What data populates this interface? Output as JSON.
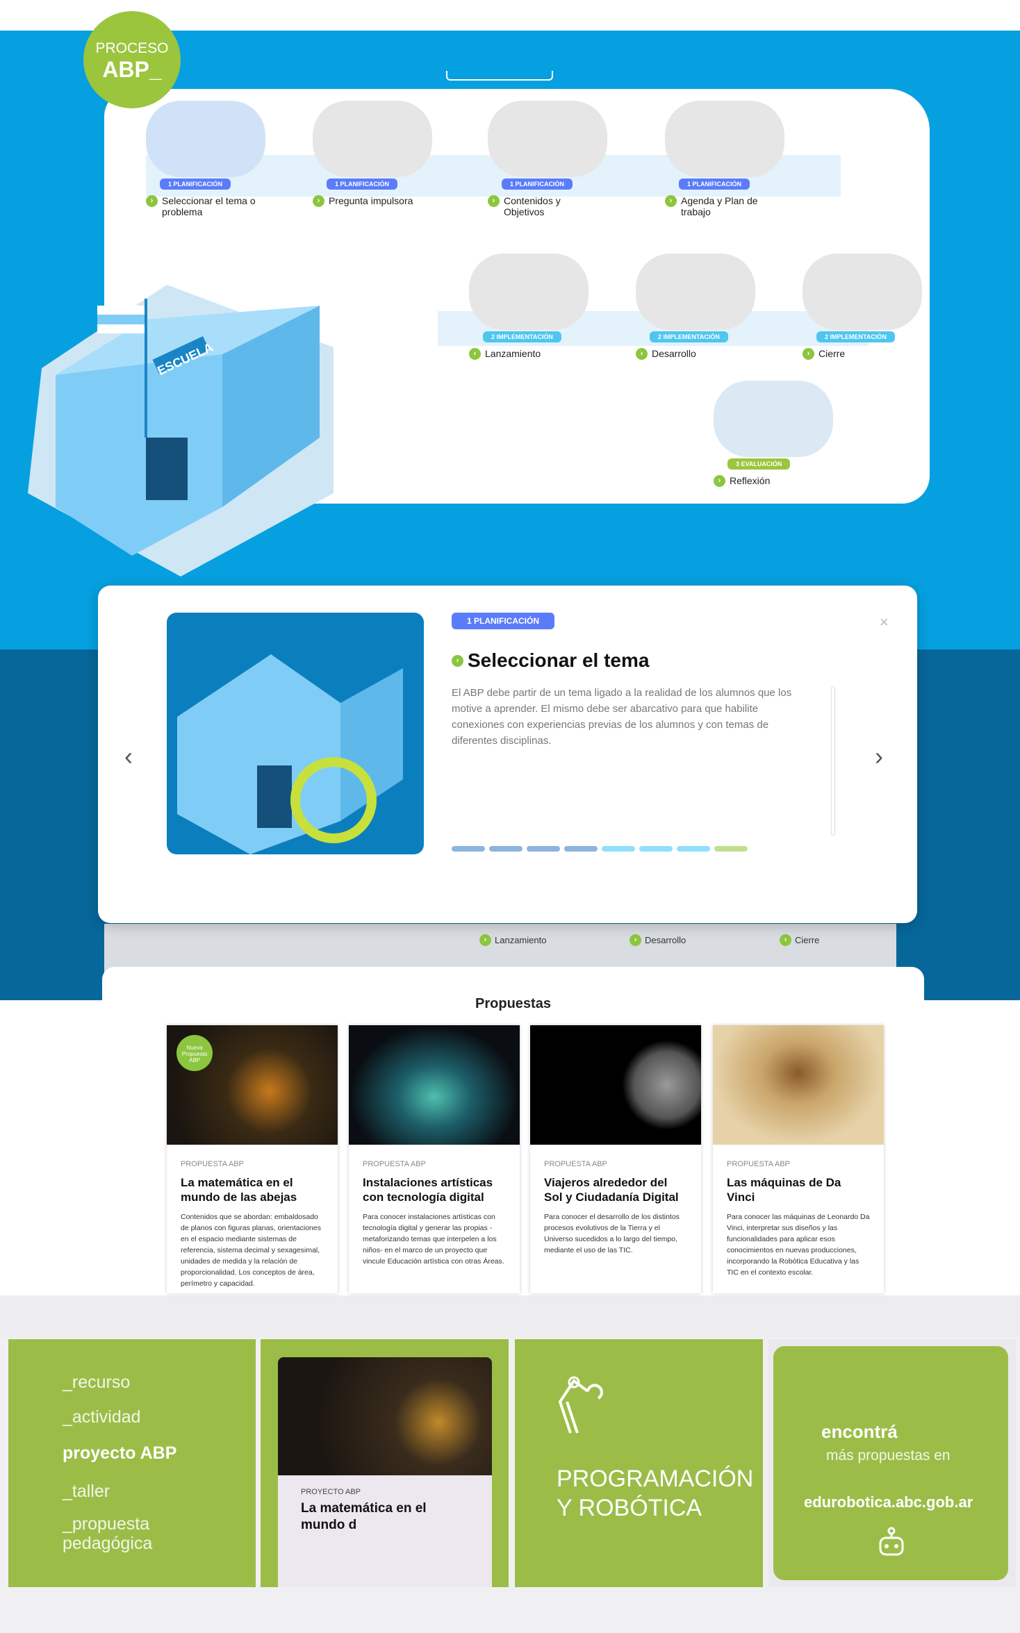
{
  "logo": {
    "line1": "PROCESO",
    "line2": "ABP_"
  },
  "steps": [
    {
      "badge": "1 PLANIFICACIÓN",
      "label": "Seleccionar el tema o problema",
      "phase": 1
    },
    {
      "badge": "1 PLANIFICACIÓN",
      "label": "Pregunta impulsora",
      "phase": 1
    },
    {
      "badge": "1 PLANIFICACIÓN",
      "label": "Contenidos y Objetivos",
      "phase": 1
    },
    {
      "badge": "1 PLANIFICACIÓN",
      "label": "Agenda y Plan de trabajo",
      "phase": 1
    },
    {
      "badge": "2 IMPLEMENTACIÓN",
      "label": "Lanzamiento",
      "phase": 2
    },
    {
      "badge": "2 IMPLEMENTACIÓN",
      "label": "Desarrollo",
      "phase": 2
    },
    {
      "badge": "2 IMPLEMENTACIÓN",
      "label": "Cierre",
      "phase": 2
    },
    {
      "badge": "3 EVALUACIÓN",
      "label": "Reflexión",
      "phase": 3
    }
  ],
  "school_sign": "ESCUELA",
  "modal": {
    "badge": "1 PLANIFICACIÓN",
    "title": "Seleccionar el tema",
    "text": "El ABP debe partir de un tema ligado a la realidad de los alumnos que los motive a aprender. El mismo debe ser abarcativo para que habilite conexiones con experiencias previas de los alumnos y con temas de diferentes disciplinas.",
    "close": "×",
    "prev": "‹",
    "next": "›",
    "current_step": 1,
    "total_steps": 8
  },
  "colors": {
    "blue": "#06a0e0",
    "dark_blue": "#07679a",
    "green": "#9bc53d",
    "planificacion": "#5b7cfa",
    "implementacion": "#4fc6ef",
    "evaluacion": "#9bc53d"
  },
  "behind_labels": [
    "Lanzamiento",
    "Desarrollo",
    "Cierre"
  ],
  "propuestas": {
    "title": "Propuestas",
    "cards": [
      {
        "kind": "PROPUESTA ABP",
        "title": "La matemática en el mundo de las abejas",
        "desc": "Contenidos que se abordan: embaldosado de planos con figuras planas, orientaciones en el espacio mediante sistemas de referencia, sistema decimal y sexagesimal, unidades de medida y la relación de proporcionalidad. Los conceptos de área, perímetro y capacidad.",
        "sticker": "Nueva Propuesta ABP"
      },
      {
        "kind": "PROPUESTA ABP",
        "title": "Instalaciones artísticas con tecnología digital",
        "desc": "Para conocer instalaciones artísticas con tecnología digital y generar las propias -metaforizando temas que interpelen a los niños- en el marco de un proyecto que vincule Educación artística con otras Áreas."
      },
      {
        "kind": "PROPUESTA ABP",
        "title": "Viajeros alrededor del Sol y Ciudadanía Digital",
        "desc": "Para conocer el desarrollo de los distintos procesos evolutivos de la Tierra y el Universo sucedidos a lo largo del tiempo, mediante el uso de las TIC."
      },
      {
        "kind": "PROPUESTA ABP",
        "title": "Las máquinas de Da Vinci",
        "desc": "Para conocer las máquinas de Leonardo Da Vinci, interpretar sus diseños y las funcionalidades para aplicar esos conocimientos en nuevas producciones, incorporando la Robótica Educativa y las TIC en el contexto escolar."
      }
    ]
  },
  "banner": {
    "menu": [
      "_recurso",
      "_actividad",
      "proyecto ABP",
      "_taller",
      "_propuesta pedagógica"
    ],
    "card_kind": "PROYECTO ABP",
    "card_title": "La matemática en el mundo d",
    "prog_line1": "PROGRAMACIÓN",
    "prog_line2": "Y ROBÓTICA",
    "find_1": "encontrá",
    "find_2": "más propuestas en",
    "site": "edurobotica.abc.gob.ar"
  }
}
